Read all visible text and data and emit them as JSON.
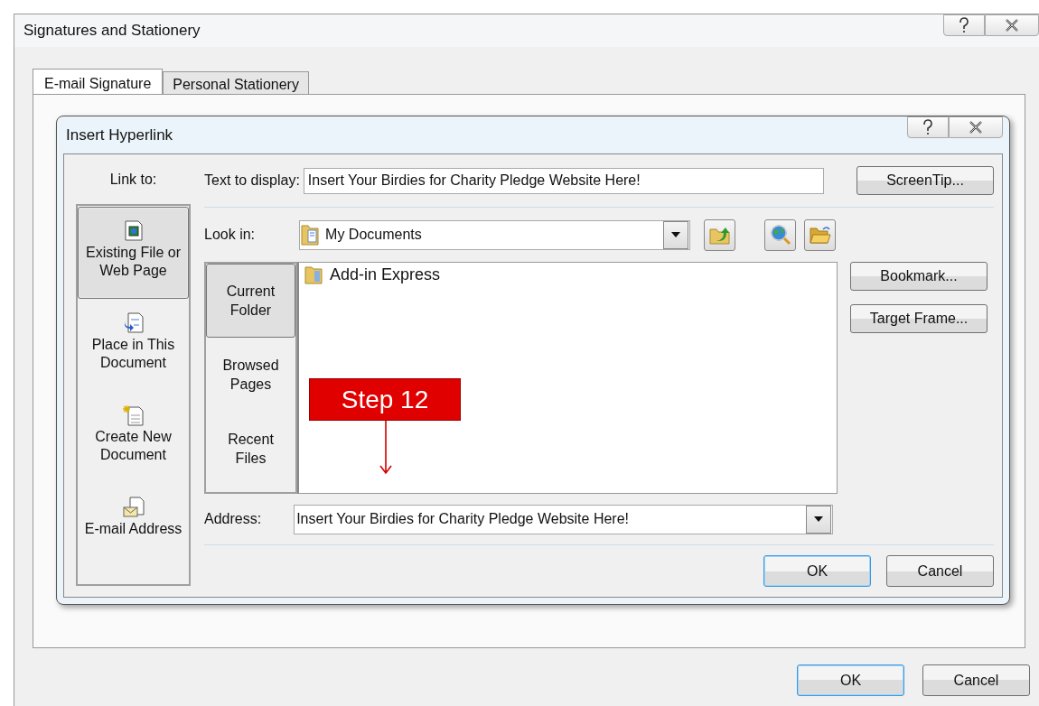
{
  "window": {
    "title": "Signatures and Stationery"
  },
  "tabs": [
    {
      "label": "E-mail Signature",
      "selected": true
    },
    {
      "label": "Personal Stationery",
      "selected": false
    }
  ],
  "dialog": {
    "title": "Insert Hyperlink",
    "link_to_label": "Link to:",
    "link_to": [
      {
        "label": "Existing File or Web Page",
        "selected": true
      },
      {
        "label": "Place in This Document",
        "selected": false
      },
      {
        "label": "Create New Document",
        "selected": false
      },
      {
        "label": "E-mail Address",
        "selected": false
      }
    ],
    "text_to_display": {
      "label": "Text to display:",
      "value": "Insert Your Birdies for Charity Pledge Website Here!"
    },
    "screentip_button": "ScreenTip...",
    "look_in": {
      "label": "Look in:",
      "value": "My Documents"
    },
    "folder_tabs": [
      {
        "label": "Current Folder",
        "selected": true
      },
      {
        "label": "Browsed Pages",
        "selected": false
      },
      {
        "label": "Recent Files",
        "selected": false
      }
    ],
    "files": [
      {
        "name": "Add-in Express"
      }
    ],
    "side_buttons": [
      "Bookmark...",
      "Target Frame..."
    ],
    "address": {
      "label": "Address:",
      "value": "Insert Your Birdies for Charity Pledge Website Here!"
    },
    "buttons": [
      {
        "label": "OK",
        "default": true
      },
      {
        "label": "Cancel",
        "default": false
      }
    ]
  },
  "annotation": {
    "label": "Step 12"
  },
  "buttons": [
    {
      "label": "OK",
      "default": true
    },
    {
      "label": "Cancel",
      "default": false
    }
  ]
}
